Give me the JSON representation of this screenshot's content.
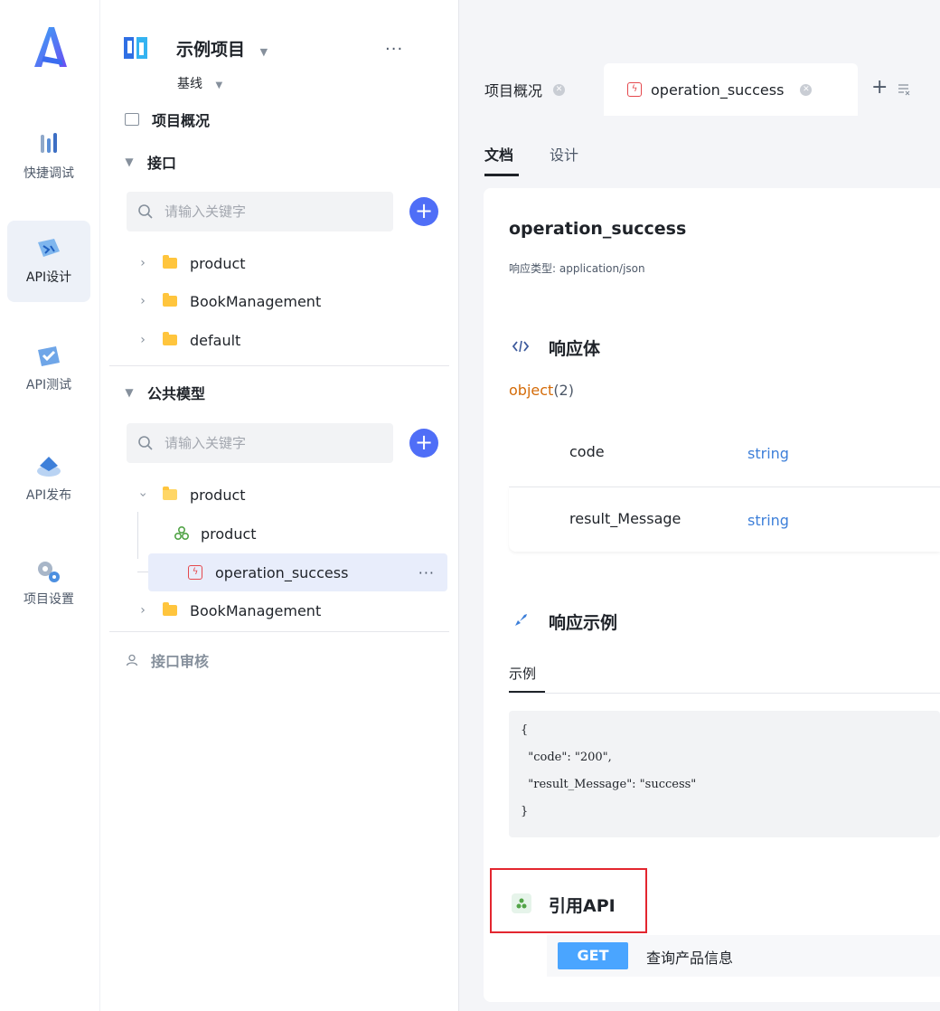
{
  "rail": {
    "items": [
      {
        "label": "快捷调试",
        "icon": "quick-debug-icon"
      },
      {
        "label": "API设计",
        "icon": "api-design-icon",
        "active": true
      },
      {
        "label": "API测试",
        "icon": "api-test-icon"
      },
      {
        "label": "API发布",
        "icon": "api-publish-icon"
      },
      {
        "label": "项目设置",
        "icon": "project-settings-icon"
      }
    ]
  },
  "sidebar": {
    "project_name": "示例项目",
    "branch": "基线",
    "more": "···",
    "overview_label": "项目概况",
    "interfaces_label": "接口",
    "interfaces_search_placeholder": "请输入关键字",
    "interface_folders": [
      "product",
      "BookManagement",
      "default"
    ],
    "models_label": "公共模型",
    "models_search_placeholder": "请输入关键字",
    "model_folder": "product",
    "model_children": [
      {
        "label": "product",
        "icon": "model-icon"
      },
      {
        "label": "operation_success",
        "icon": "response-icon",
        "selected": true
      }
    ],
    "model_folder_2": "BookManagement",
    "review_label": "接口审核",
    "row_more": "···"
  },
  "tabs": {
    "items": [
      {
        "label": "项目概况"
      },
      {
        "label": "operation_success",
        "active": true
      }
    ],
    "add": "+",
    "close_glyph": "✕"
  },
  "subtabs": {
    "doc": "文档",
    "design": "设计"
  },
  "doc": {
    "title": "operation_success",
    "response_type_label": "响应类型: application/json",
    "body_title": "响应体",
    "body_type": "object",
    "body_count": "(2)",
    "fields": [
      {
        "name": "code",
        "type": "string"
      },
      {
        "name": "result_Message",
        "type": "string"
      }
    ],
    "example_title": "响应示例",
    "example_tab": "示例",
    "example_lines": [
      "{",
      "  \"code\": \"200\",",
      "  \"result_Message\": \"success\"",
      "}"
    ],
    "ref_title": "引用API",
    "ref_method": "GET",
    "ref_name": "查询产品信息"
  },
  "colors": {
    "accent": "#4f6ef7",
    "object_orange": "#d46b08",
    "string_blue": "#3d7fd9",
    "highlight_red": "#e3262f",
    "get_badge": "#4aa5ff"
  }
}
